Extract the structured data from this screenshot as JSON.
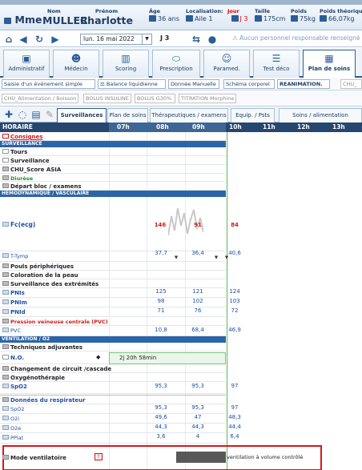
{
  "patient": {
    "civ": "Mme",
    "nom_label": "Nom",
    "nom": "MULLER",
    "prenom_label": "Prénom",
    "prenom": "Charlotte",
    "age_label": "Âge",
    "age": "36 ans",
    "localisation_label": "Localisation:",
    "localisation": "Aile 1",
    "jour_label": "Jour",
    "jour": "J 3",
    "taille_label": "Taille",
    "taille": "175cm",
    "poids_label": "Poids",
    "poids": "75kg",
    "poids_theo_label": "Poids théorique",
    "poids_theo": "66,07kg"
  },
  "nav": {
    "date": "lun. 16 mai 2022",
    "day": "J 3",
    "warning": "Aucun personnel responsable renseigné pour"
  },
  "main_tabs": [
    {
      "label": "Administratif",
      "icon": "file-icon"
    },
    {
      "label": "Médecin",
      "icon": "doctor-icon"
    },
    {
      "label": "Scoring",
      "icon": "chart-icon"
    },
    {
      "label": "Prescription",
      "icon": "pill-icon"
    },
    {
      "label": "Paramed.",
      "icon": "nurse-icon"
    },
    {
      "label": "Test déco",
      "icon": "list-icon"
    },
    {
      "label": "Plan de soins",
      "icon": "grid-icon",
      "active": true
    }
  ],
  "actions1": [
    "Saisie d'un événement simple",
    "Balance liquidienne",
    "Donnée Manuelle",
    "Schéma corporel",
    "REANIMATION.",
    "CHU_"
  ],
  "actions2": [
    "CHU_Alimentation / Boisson",
    "BOLUS INSULINE",
    "BOLUS G30%",
    "TITRATION Morphine"
  ],
  "subtabs": [
    "Surveillances",
    "Plan de soins",
    "Thérapeutiques / examens",
    "Equip. / Psts",
    "Soins / alimentation"
  ],
  "grid": {
    "header": "HORAIRE",
    "hours": [
      "07h",
      "08h",
      "09h",
      "10h",
      "11h",
      "12h",
      "13h"
    ],
    "sections": [
      "SURVEILLANCE",
      "HEMODYNAMIQUE / VASCULAIRE",
      "VENTILATION / O2"
    ],
    "rows": {
      "consignes": "Consignes",
      "tours": "Tours",
      "surveillance": "Surveillance",
      "score": "CHU_Score ASIA",
      "diurese": "Diurèse",
      "depart": "Départ bloc / examens",
      "fc": "Fc(ecg)",
      "ttymp": "T-Tymp",
      "pouls": "Pouls périphériques",
      "coloration": "Coloration de la peau",
      "extremites": "Surveillance des extrémités",
      "pnis": "PNIs",
      "pnim": "PNIm",
      "pnid": "PNId",
      "pvc_title": "Pression veineuse centrale (PVC)",
      "pvc": "PVC",
      "techniques": "Techniques adjuvantes",
      "no": "N.O.",
      "circuit": "Changement de circuit /cascade",
      "oxy": "Oxygénothérapie",
      "spo2": "SpO2",
      "resp": "Données du respirateur",
      "spo2b": "SpO2",
      "o2i": "O2i",
      "o2e": "O2e",
      "pplat": "PPlat",
      "mode": "Mode ventilatoire"
    },
    "values": {
      "fc": [
        "146",
        "91",
        "84"
      ],
      "ttymp": [
        "37,7",
        "36,4",
        "40,6"
      ],
      "pnis": [
        "125",
        "121",
        "124"
      ],
      "pnim": [
        "98",
        "102",
        "103"
      ],
      "pnid": [
        "71",
        "76",
        "72"
      ],
      "pvc": [
        "10,8",
        "68,4",
        "46,9"
      ],
      "spo2": [
        "95,3",
        "95,3",
        "97"
      ],
      "spo2b": [
        "95,3",
        "95,3",
        "97"
      ],
      "o2i": [
        "49,6",
        "47",
        "48,3"
      ],
      "o2e": [
        "44,3",
        "44,3",
        "44,4"
      ],
      "pplat": [
        "3,6",
        "4",
        "6,4"
      ]
    },
    "no_duration": "2j 20h 58min",
    "mode_text": "ventilation à volume contrôlé"
  },
  "colors": {
    "header": "#25466f",
    "section": "#2c64a8",
    "value": "#1f4fa3",
    "alert": "#d21919"
  }
}
